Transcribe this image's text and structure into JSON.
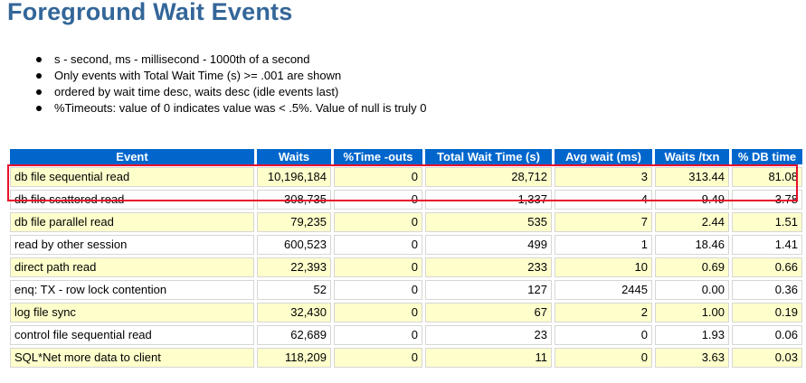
{
  "title": "Foreground Wait Events",
  "notes": [
    "s - second, ms - millisecond - 1000th of a second",
    "Only events with Total Wait Time (s) >= .001 are shown",
    "ordered by wait time desc, waits desc (idle events last)",
    "%Timeouts: value of 0 indicates value was < .5%. Value of null is truly 0"
  ],
  "table": {
    "headers": [
      "Event",
      "Waits",
      "%Time -outs",
      "Total Wait Time (s)",
      "Avg wait (ms)",
      "Waits /txn",
      "% DB time"
    ],
    "header_color": "#0066cc",
    "row_colors": [
      "#ffffcc",
      "#ffffff"
    ],
    "rows": [
      [
        "db file sequential read",
        "10,196,184",
        "0",
        "28,712",
        "3",
        "313.44",
        "81.08"
      ],
      [
        "db file scattered read",
        "308,735",
        "0",
        "1,337",
        "4",
        "9.49",
        "3.78"
      ],
      [
        "db file parallel read",
        "79,235",
        "0",
        "535",
        "7",
        "2.44",
        "1.51"
      ],
      [
        "read by other session",
        "600,523",
        "0",
        "499",
        "1",
        "18.46",
        "1.41"
      ],
      [
        "direct path read",
        "22,393",
        "0",
        "233",
        "10",
        "0.69",
        "0.66"
      ],
      [
        "enq: TX - row lock contention",
        "52",
        "0",
        "127",
        "2445",
        "0.00",
        "0.36"
      ],
      [
        "log file sync",
        "32,430",
        "0",
        "67",
        "2",
        "1.00",
        "0.19"
      ],
      [
        "control file sequential read",
        "62,689",
        "0",
        "23",
        "0",
        "1.93",
        "0.06"
      ],
      [
        "SQL*Net more data to client",
        "118,209",
        "0",
        "11",
        "0",
        "3.63",
        "0.03"
      ]
    ]
  },
  "highlight": {
    "row_index": 0,
    "color": "#e8102a"
  }
}
